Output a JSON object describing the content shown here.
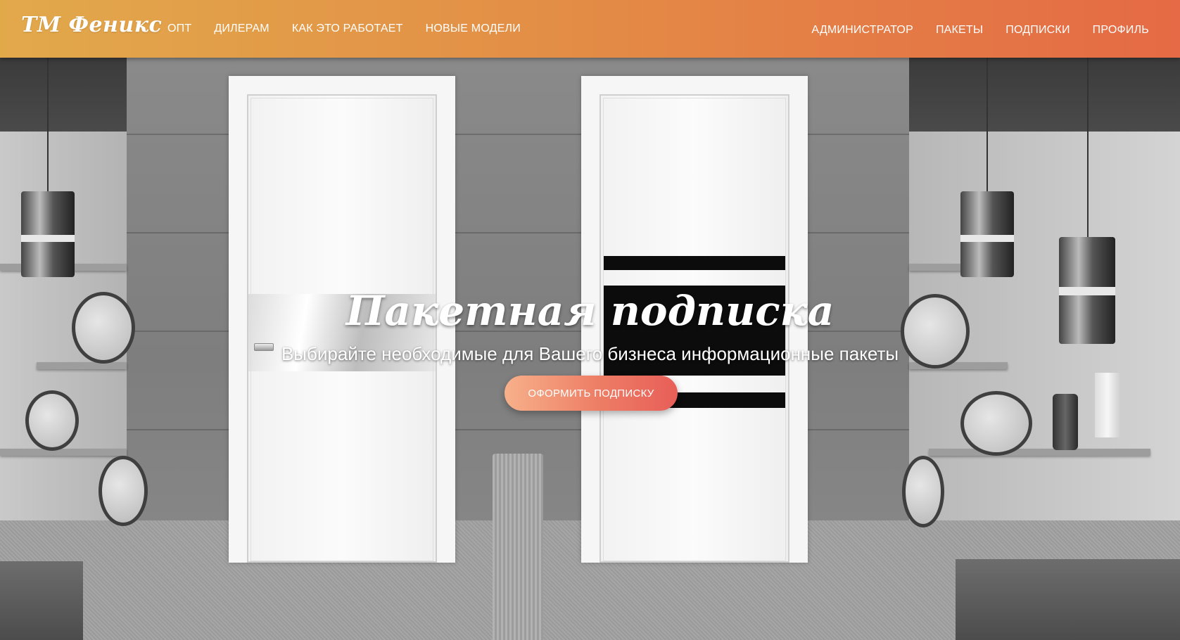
{
  "brand": {
    "name": "ТМ Феникс"
  },
  "nav": {
    "left": [
      {
        "label": "ОПТ"
      },
      {
        "label": "ДИЛЕРАМ"
      },
      {
        "label": "КАК ЭТО РАБОТАЕТ"
      },
      {
        "label": "НОВЫЕ МОДЕЛИ"
      }
    ],
    "right": [
      {
        "label": "АДМИНИСТРАТОР"
      },
      {
        "label": "ПАКЕТЫ"
      },
      {
        "label": "ПОДПИСКИ"
      },
      {
        "label": "ПРОФИЛЬ"
      }
    ]
  },
  "hero": {
    "title": "Пакетная подписка",
    "subtitle": "Выбирайте необходимые для Вашего бизнеса информационные пакеты",
    "cta_label": "ОФОРМИТЬ ПОДПИСКУ"
  },
  "colors": {
    "navbar_gradient_start": "#e2a94b",
    "navbar_gradient_end": "#e56a45",
    "cta_gradient_start": "#f7b08a",
    "cta_gradient_end": "#e85e58"
  }
}
